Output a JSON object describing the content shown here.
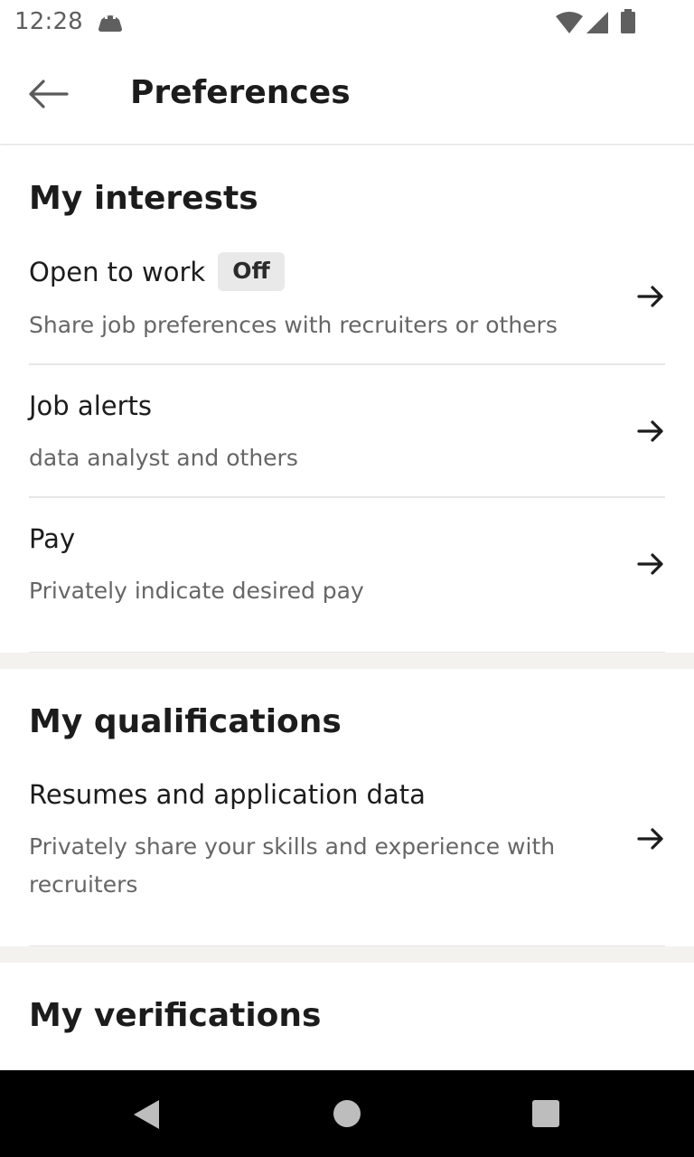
{
  "status_bar": {
    "time": "12:28",
    "icons": [
      "debug-icon",
      "wifi-icon",
      "signal-icon",
      "battery-icon"
    ]
  },
  "app_bar": {
    "title": "Preferences",
    "back_icon": "arrow-left-icon"
  },
  "sections": {
    "interests": {
      "title": "My interests",
      "items": [
        {
          "title": "Open to work",
          "badge": "Off",
          "subtitle": "Share job preferences with recruiters or others"
        },
        {
          "title": "Job alerts",
          "subtitle": "data analyst and others"
        },
        {
          "title": "Pay",
          "subtitle": "Privately indicate desired pay"
        }
      ]
    },
    "qualifications": {
      "title": "My qualifications",
      "items": [
        {
          "title": "Resumes and application data",
          "subtitle": "Privately share your skills and experience with recruiters"
        }
      ]
    },
    "verifications": {
      "title": "My verifications"
    }
  },
  "nav_bar": {
    "icons": [
      "nav-back-icon",
      "nav-home-icon",
      "nav-recents-icon"
    ]
  },
  "colors": {
    "text_primary": "#1c1c1c",
    "text_secondary": "#666666",
    "section_gap": "#f3f2ef",
    "badge_bg": "#e9e9e9",
    "nav_bar": "#000000"
  }
}
